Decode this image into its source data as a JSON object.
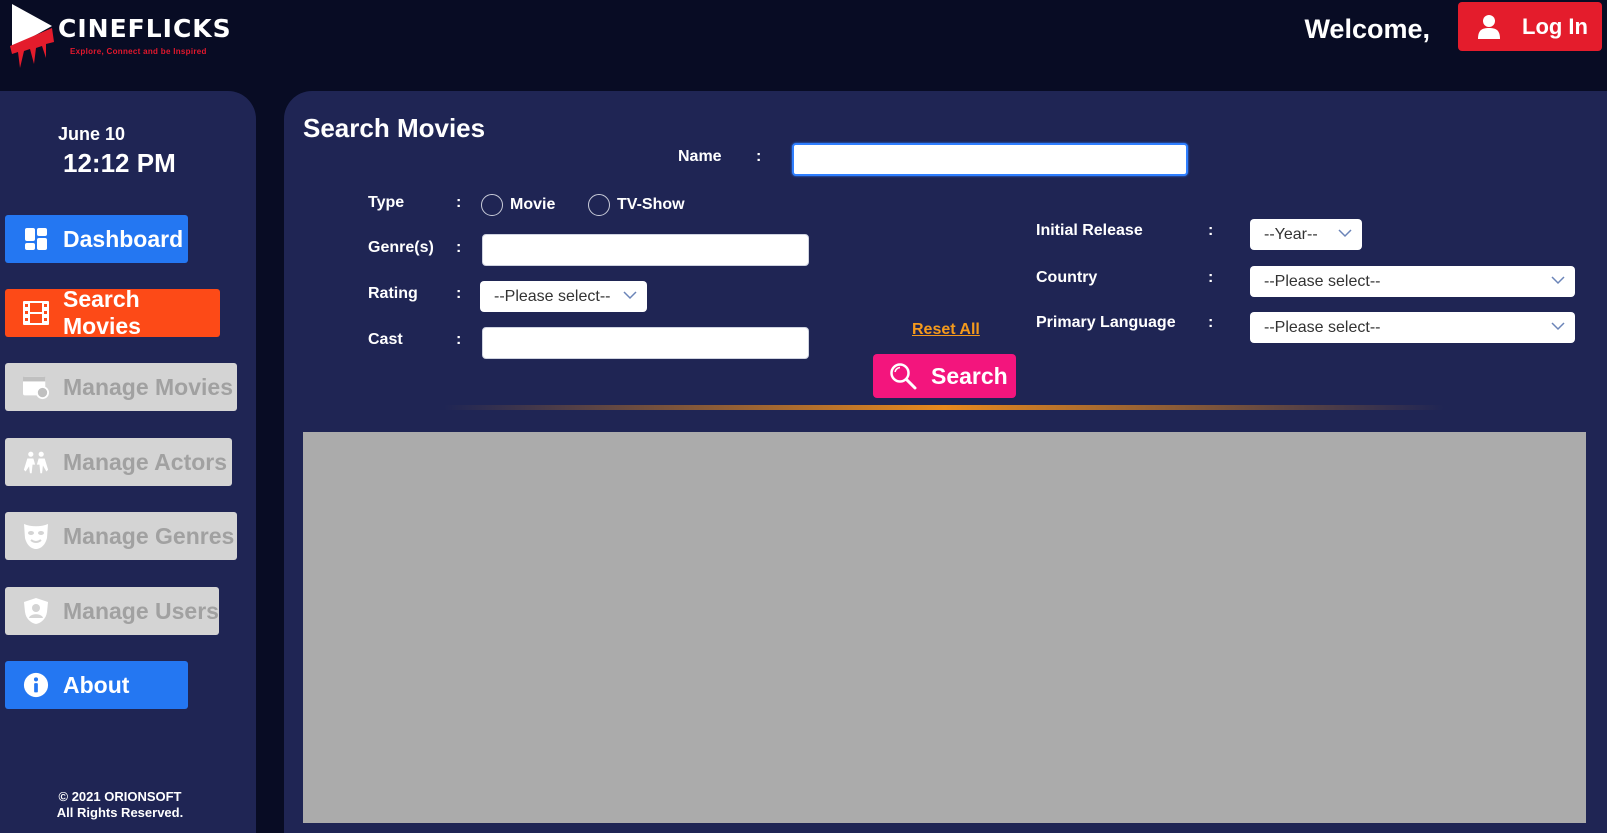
{
  "header": {
    "logo_title": "CINEFLICKS",
    "logo_tagline": "Explore, Connect and be Inspired",
    "welcome": "Welcome,",
    "login_label": "Log In"
  },
  "sidebar": {
    "date": "June 10",
    "time": "12:12 PM",
    "items": [
      {
        "label": "Dashboard",
        "icon": "dashboard-icon",
        "state": "enabled"
      },
      {
        "label": "Search Movies",
        "icon": "film-icon",
        "state": "active"
      },
      {
        "label": "Manage Movies",
        "icon": "movie-settings-icon",
        "state": "disabled"
      },
      {
        "label": "Manage Actors",
        "icon": "actors-icon",
        "state": "disabled"
      },
      {
        "label": "Manage Genres",
        "icon": "mask-icon",
        "state": "disabled"
      },
      {
        "label": "Manage Users",
        "icon": "user-shield-icon",
        "state": "disabled"
      },
      {
        "label": "About",
        "icon": "info-icon",
        "state": "enabled"
      }
    ],
    "copyright_line1": "© 2021 ORIONSOFT",
    "copyright_line2": "All Rights Reserved."
  },
  "main": {
    "title": "Search Movies",
    "form": {
      "name_label": "Name",
      "name_value": "",
      "type_label": "Type",
      "type_options": [
        "Movie",
        "TV-Show"
      ],
      "genres_label": "Genre(s)",
      "genres_value": "",
      "rating_label": "Rating",
      "rating_value": "--Please select--",
      "cast_label": "Cast",
      "cast_value": "",
      "initial_release_label": "Initial Release",
      "year_value": "--Year--",
      "country_label": "Country",
      "country_value": "--Please select--",
      "language_label": "Primary Language",
      "language_value": "--Please select--",
      "colon": ":",
      "reset_label": "Reset All",
      "search_label": "Search"
    }
  },
  "colors": {
    "background": "#080c24",
    "panel": "#1f2554",
    "accent_blue": "#2477f2",
    "accent_orange": "#fd4a17",
    "accent_pink": "#f3157d",
    "login_red": "#e41c2c",
    "results_gray": "#ababab"
  }
}
